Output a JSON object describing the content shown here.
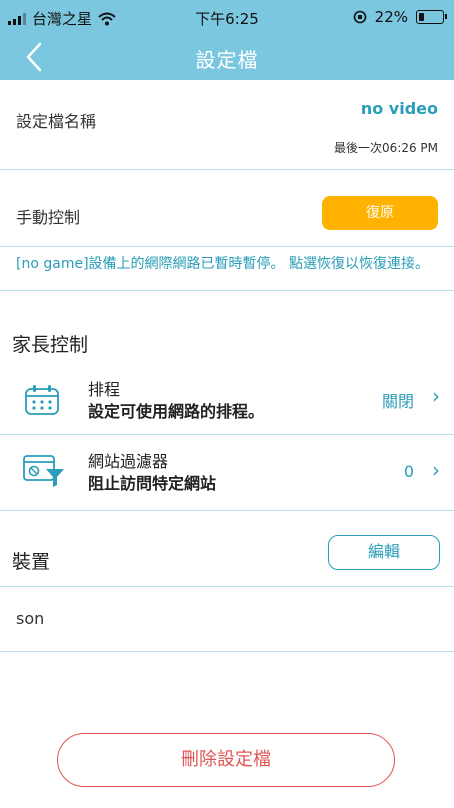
{
  "status_bar": {
    "carrier": "台灣之星",
    "time": "下午6:25",
    "battery": "22%",
    "battery_level": 0.22
  },
  "nav": {
    "title": "設定檔"
  },
  "profile": {
    "name_label": "設定檔名稱",
    "name_value": "no video",
    "last_updated": "最後一次06:26 PM"
  },
  "manual_control": {
    "label": "手動控制",
    "restore_button": "復原",
    "message": "[no game]設備上的網際網路已暫時暫停。 點選恢復以恢復連接。"
  },
  "parental_controls": {
    "heading": "家長控制",
    "items": [
      {
        "icon": "calendar-icon",
        "title": "排程",
        "subtitle": "設定可使用網路的排程。",
        "value": "關閉"
      },
      {
        "icon": "website-filter-icon",
        "title": "網站過濾器",
        "subtitle": "阻止訪問特定網站",
        "value": "0"
      }
    ]
  },
  "devices": {
    "heading": "裝置",
    "edit_button": "編輯",
    "items": [
      "son"
    ]
  },
  "delete_button": "刪除設定檔",
  "colors": {
    "accent": "#2a9db8",
    "header": "#7cc7e0",
    "restore": "#ffb300",
    "danger": "#e05555"
  }
}
